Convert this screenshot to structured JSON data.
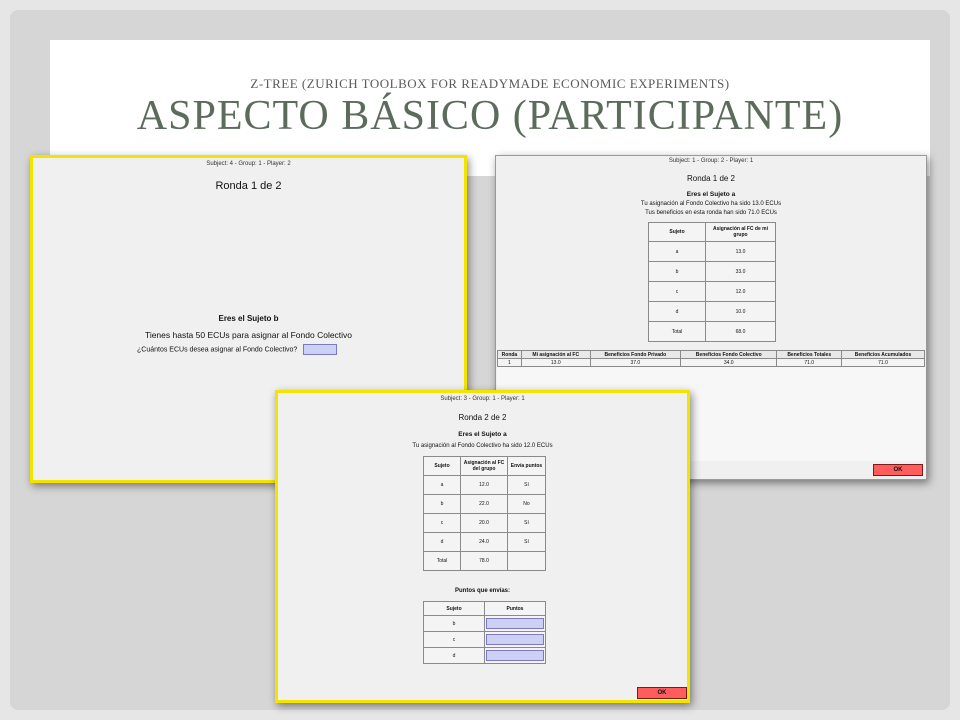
{
  "slide": {
    "subtitle": "Z-TREE (ZURICH TOOLBOX FOR READYMADE ECONOMIC EXPERIMENTS)",
    "title": "ASPECTO BÁSICO (PARTICIPANTE)"
  },
  "win1": {
    "header": "Subject: 4 - Group: 1 - Player: 2",
    "round": "Ronda 1 de 2",
    "role": "Eres el Sujeto b",
    "info": "Tienes hasta 50 ECUs para asignar al Fondo Colectivo",
    "question": "¿Cuántos ECUs desea asignar al Fondo Colectivo?"
  },
  "win2": {
    "header": "Subject: 1 - Group: 2 - Player: 1",
    "round": "Ronda 1 de 2",
    "role": "Eres el Sujeto a",
    "line1": "Tu asignación al Fondo Colectivo ha sido 13.0 ECUs",
    "line2": "Tus beneficios en esta ronda han sido  71.0 ECUs",
    "table_headers": [
      "Sujeto",
      "Asignación al FC de mi grupo"
    ],
    "table_rows": [
      [
        "a",
        "13.0"
      ],
      [
        "b",
        "33.0"
      ],
      [
        "c",
        "12.0"
      ],
      [
        "d",
        "10.0"
      ],
      [
        "Total",
        "68.0"
      ]
    ],
    "history_headers": [
      "Ronda",
      "Mi asignación al FC",
      "Beneficios Fondo Privado",
      "Beneficios Fondo Colectivo",
      "Beneficios Totales",
      "Beneficios Acumulados"
    ],
    "history_row": [
      "1",
      "13.0",
      "37.0",
      "34.0",
      "71.0",
      "71.0"
    ],
    "ok": "OK"
  },
  "win3": {
    "header": "Subject: 3 - Group: 1 - Player: 1",
    "round": "Ronda 2 de 2",
    "role": "Eres el Sujeto a",
    "line1": "Tu asignación al Fondo Colectivo ha sido 12.0 ECUs",
    "table_headers": [
      "Sujeto",
      "Asignación al FC del grupo",
      "Envía puntos"
    ],
    "table_rows": [
      [
        "a",
        "12.0",
        "Sí"
      ],
      [
        "b",
        "22.0",
        "No"
      ],
      [
        "c",
        "20.0",
        "Sí"
      ],
      [
        "d",
        "24.0",
        "Sí"
      ],
      [
        "Total",
        "78.0",
        ""
      ]
    ],
    "points_title": "Puntos que envías:",
    "points_headers": [
      "Sujeto",
      "Puntos"
    ],
    "points_rows": [
      "b",
      "c",
      "d"
    ],
    "ok": "OK"
  }
}
